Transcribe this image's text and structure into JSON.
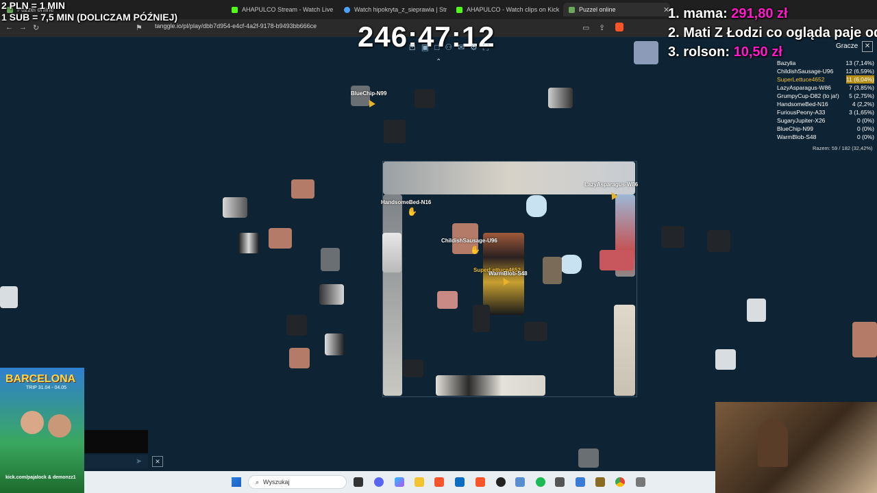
{
  "browser": {
    "tabs": [
      {
        "label": "Puzzel online"
      },
      {
        "label": "AHAPULCO Stream - Watch Live on Kick"
      },
      {
        "label": "Watch hipokryta_z_sieprawia | Stream"
      },
      {
        "label": "AHAPULCO - Watch clips on Kick"
      },
      {
        "label": "Puzzel online"
      }
    ],
    "url": "tanggle.io/pl/play/dbb7d954-e4cf-4a2f-9178-b9493bb666ce"
  },
  "overlay": {
    "rule_line1": "2 PLN = 1 MIN",
    "rule_line2": "1 SUB = 7,5 MIN (DOLICZAM PÓŹNIEJ)",
    "timer": "246:47:12",
    "donors": [
      {
        "rank": "1.",
        "name": "mama:",
        "amount": "291,80 zł"
      },
      {
        "rank": "2.",
        "name": "Mati Z Łodzi co ogląda paje od",
        "amount": ""
      },
      {
        "rank": "3.",
        "name": "rolson:",
        "amount": "10,50 zł"
      }
    ]
  },
  "game": {
    "cursors": [
      {
        "name": "BlueChip-N99"
      },
      {
        "name": "LazyAsparagus-W86"
      },
      {
        "name": "HandsomeBed-N16"
      },
      {
        "name": "ChildishSausage-U96"
      },
      {
        "name": "SuperLettuce4652"
      },
      {
        "name": "WarmBlob-S48"
      }
    ],
    "players_title": "Gracze",
    "players": [
      {
        "name": "Bazylia",
        "score": "13 (7,14%)"
      },
      {
        "name": "ChildishSausage-U96",
        "score": "12 (6,59%)"
      },
      {
        "name": "SuperLettuce4652",
        "score": "11 (6,04%)"
      },
      {
        "name": "LazyAsparagus-W86",
        "score": "7 (3,85%)"
      },
      {
        "name": "GrumpyCup-D82 (to ja!)",
        "score": "5 (2,75%)"
      },
      {
        "name": "HandsomeBed-N16",
        "score": "4 (2,2%)"
      },
      {
        "name": "FuriousPeony-A33",
        "score": "3 (1,65%)"
      },
      {
        "name": "SugaryJupiter-X26",
        "score": "0 (0%)"
      },
      {
        "name": "BlueChip-N99",
        "score": "0 (0%)"
      },
      {
        "name": "WarmBlob-S48",
        "score": "0 (0%)"
      }
    ],
    "total": "Razem: 59 / 182 (32,42%)"
  },
  "promo": {
    "title": "BARCELONA",
    "subtitle": "TRIP 31.04 - 04.05",
    "footer": "kick.com/pajalock & demonzz1"
  },
  "taskbar": {
    "search_placeholder": "Wyszukaj"
  },
  "colors": {
    "background": "#0e2333",
    "donation_accent": "#ff19c8",
    "self_highlight": "#f2c230"
  }
}
